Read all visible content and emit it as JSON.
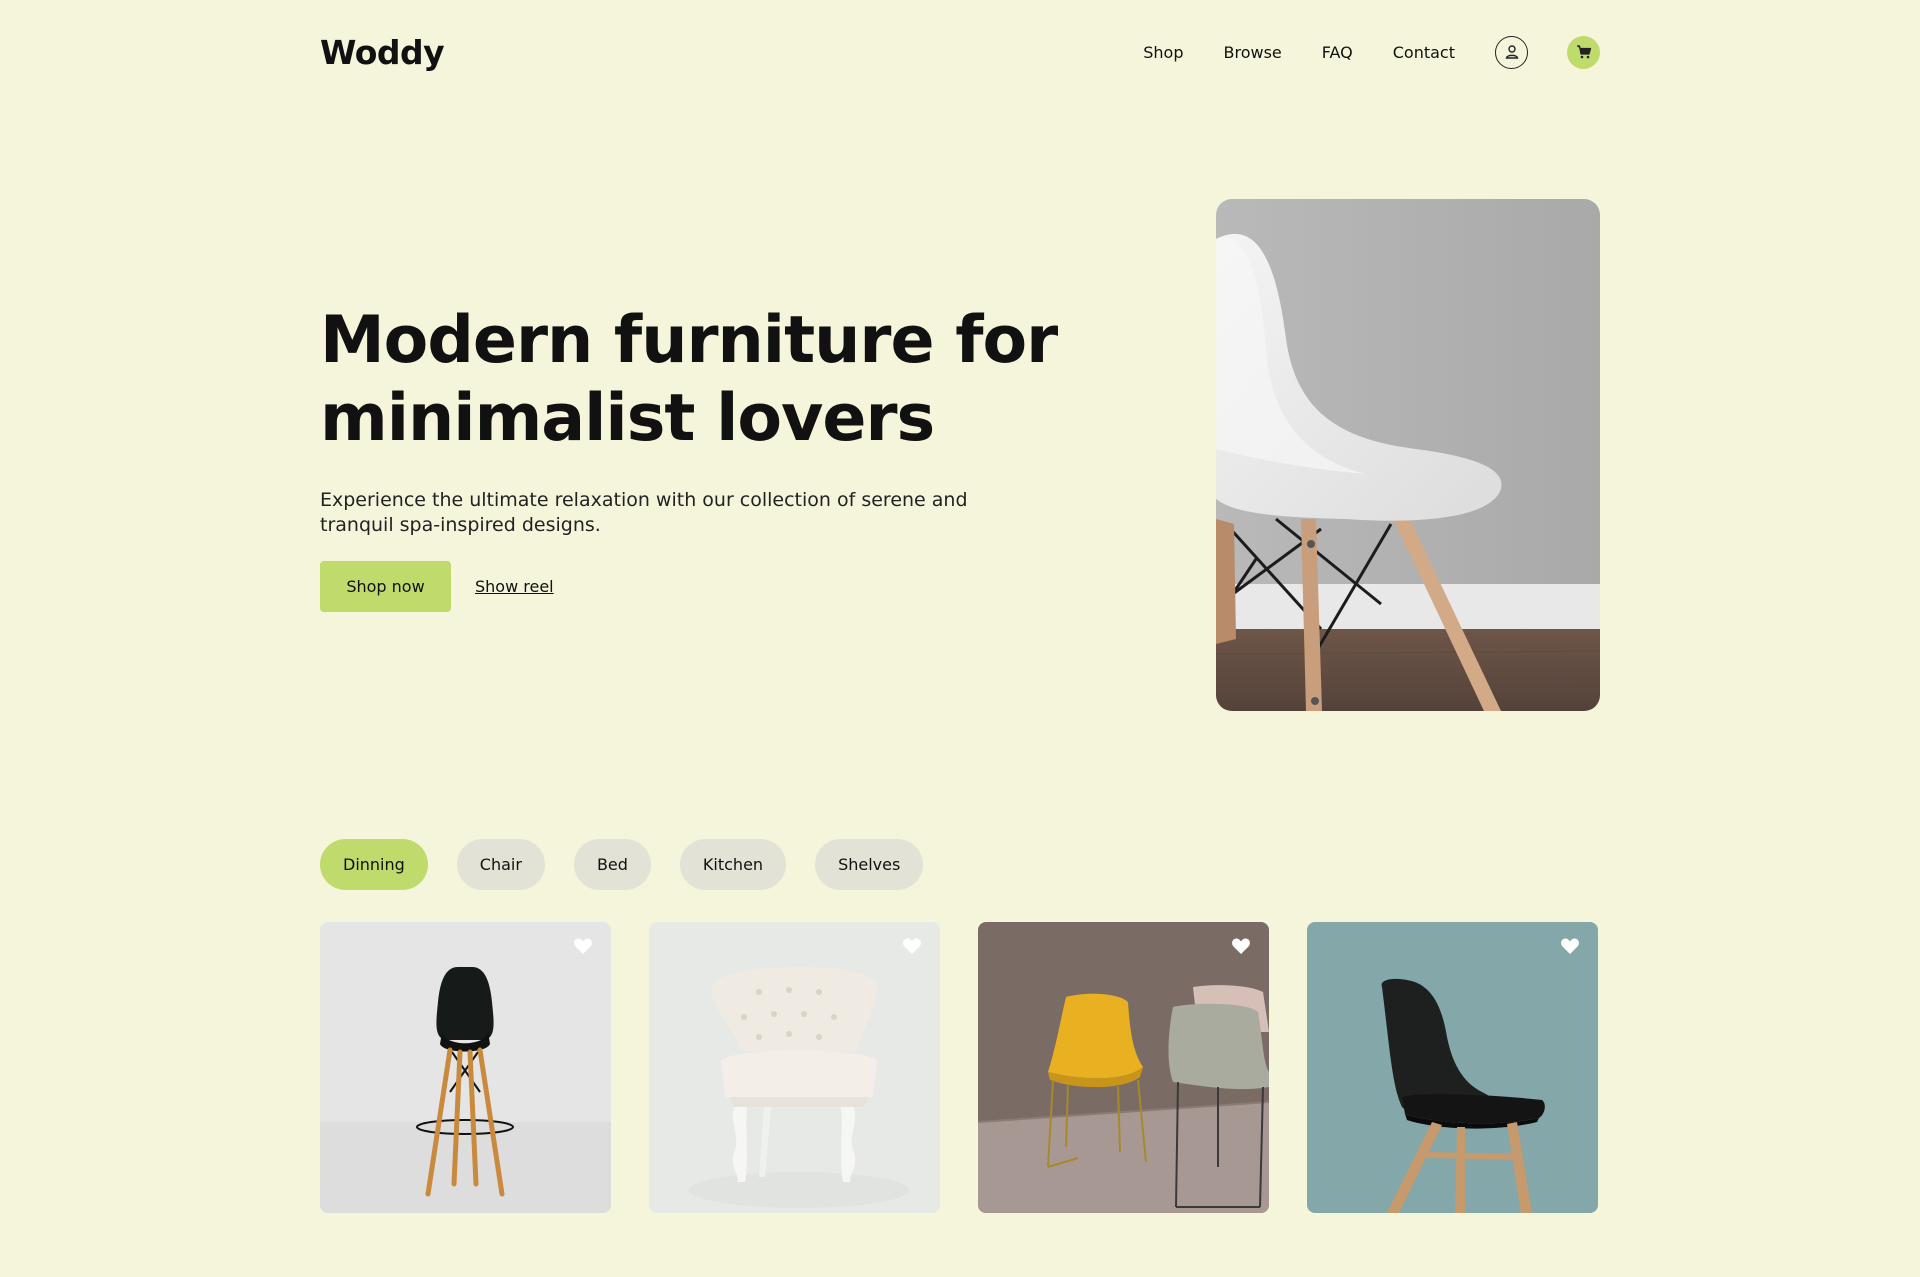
{
  "brand": {
    "name": "Woddy"
  },
  "nav": {
    "items": [
      "Shop",
      "Browse",
      "FAQ",
      "Contact"
    ],
    "user_icon": "user-icon",
    "cart_icon": "cart-icon"
  },
  "hero": {
    "title_line1": "Modern furniture for",
    "title_line2": "minimalist lovers",
    "subtitle": "Experience the ultimate relaxation with our collection of serene and tranquil spa-inspired designs.",
    "primary_cta": "Shop now",
    "secondary_cta": "Show reel"
  },
  "categories": {
    "active": "Dinning",
    "items": [
      "Dinning",
      "Chair",
      "Bed",
      "Kitchen",
      "Shelves"
    ]
  },
  "products": [
    {
      "name": "black-bar-stool",
      "background": "#e4e5e4",
      "favorite_icon": "heart-icon"
    },
    {
      "name": "white-tufted-chair",
      "background": "#e7e9e7",
      "favorite_icon": "heart-icon"
    },
    {
      "name": "yellow-and-grey-chairs",
      "background": "#7a6c65",
      "favorite_icon": "heart-icon"
    },
    {
      "name": "black-scandinavian-chair",
      "background": "#84a7a9",
      "favorite_icon": "heart-icon"
    }
  ],
  "colors": {
    "page_background": "#f5f5db",
    "accent": "#bfdb6b",
    "tab_inactive": "#e2e2d6",
    "text": "#111111"
  }
}
